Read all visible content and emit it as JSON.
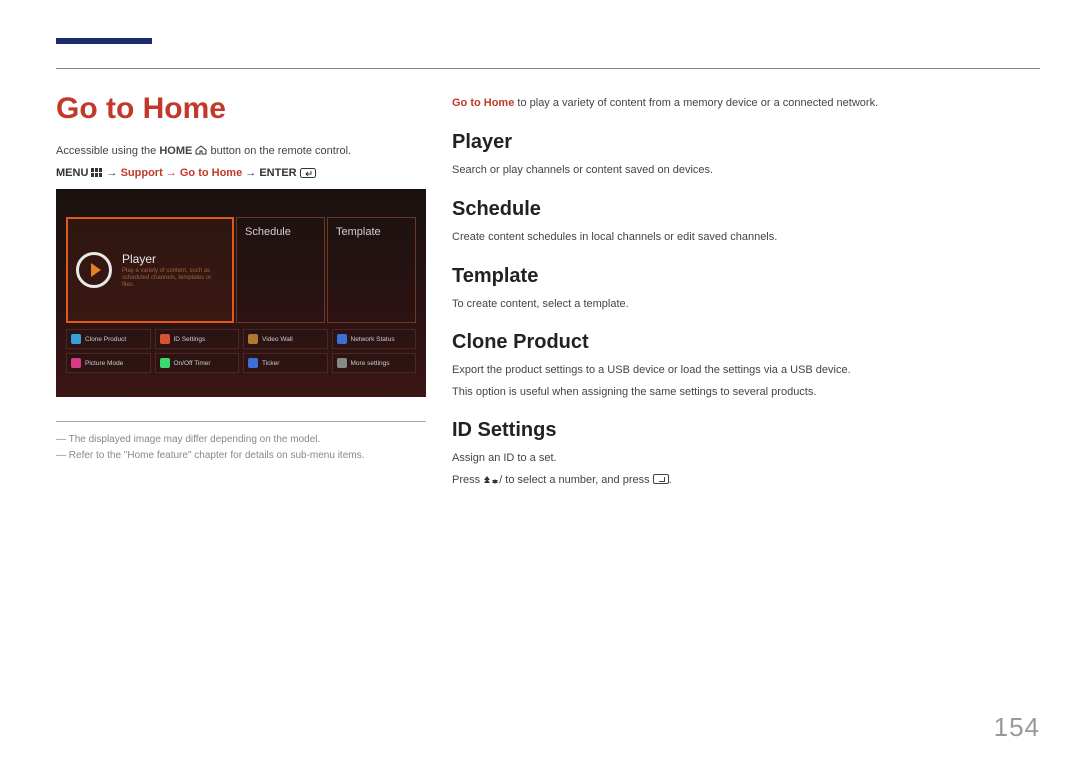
{
  "page_number": "154",
  "left": {
    "title": "Go to Home",
    "intro_pre": "Accessible using the ",
    "intro_bold": "HOME",
    "intro_post": " button on the remote control.",
    "path_menu": "MENU ",
    "path_arrow1": " → ",
    "path_support": "Support",
    "path_arrow2": " → ",
    "path_goto": "Go to Home",
    "path_arrow3": " → ",
    "path_enter": "ENTER ",
    "note1": "The displayed image may differ depending on the model.",
    "note2": "Refer to the \"Home feature\" chapter for details on sub-menu items."
  },
  "screenshot": {
    "player_title": "Player",
    "player_sub1": "Play a variety of content, such as",
    "player_sub2": "scheduled channels, templates or files.",
    "tile_schedule": "Schedule",
    "tile_template": "Template",
    "grid": [
      {
        "label": "Clone Product",
        "color": "#3aa0d8"
      },
      {
        "label": "ID Settings",
        "color": "#d85430"
      },
      {
        "label": "Video Wall",
        "color": "#b07830"
      },
      {
        "label": "Network Status",
        "color": "#3a70d8"
      },
      {
        "label": "Picture Mode",
        "color": "#d83a88"
      },
      {
        "label": "On/Off Timer",
        "color": "#3ad870"
      },
      {
        "label": "Ticker",
        "color": "#3a70d8"
      },
      {
        "label": "More settings",
        "color": "#888888"
      }
    ]
  },
  "right": {
    "lead_bold": "Go to Home",
    "lead_rest": " to play a variety of content from a memory device or a connected network.",
    "sections": {
      "player": {
        "h": "Player",
        "p": "Search or play channels or content saved on devices."
      },
      "schedule": {
        "h": "Schedule",
        "p": "Create content schedules in local channels or edit saved channels."
      },
      "template": {
        "h": "Template",
        "p": "To create content, select a template."
      },
      "clone": {
        "h": "Clone Product",
        "p1": "Export the product settings to a USB device or load the settings via a USB device.",
        "p2": "This option is useful when assigning the same settings to several products."
      },
      "id": {
        "h": "ID Settings",
        "p1": "Assign an ID to a set.",
        "p2_a": "Press ",
        "p2_b": " to select a number, and press "
      }
    }
  }
}
